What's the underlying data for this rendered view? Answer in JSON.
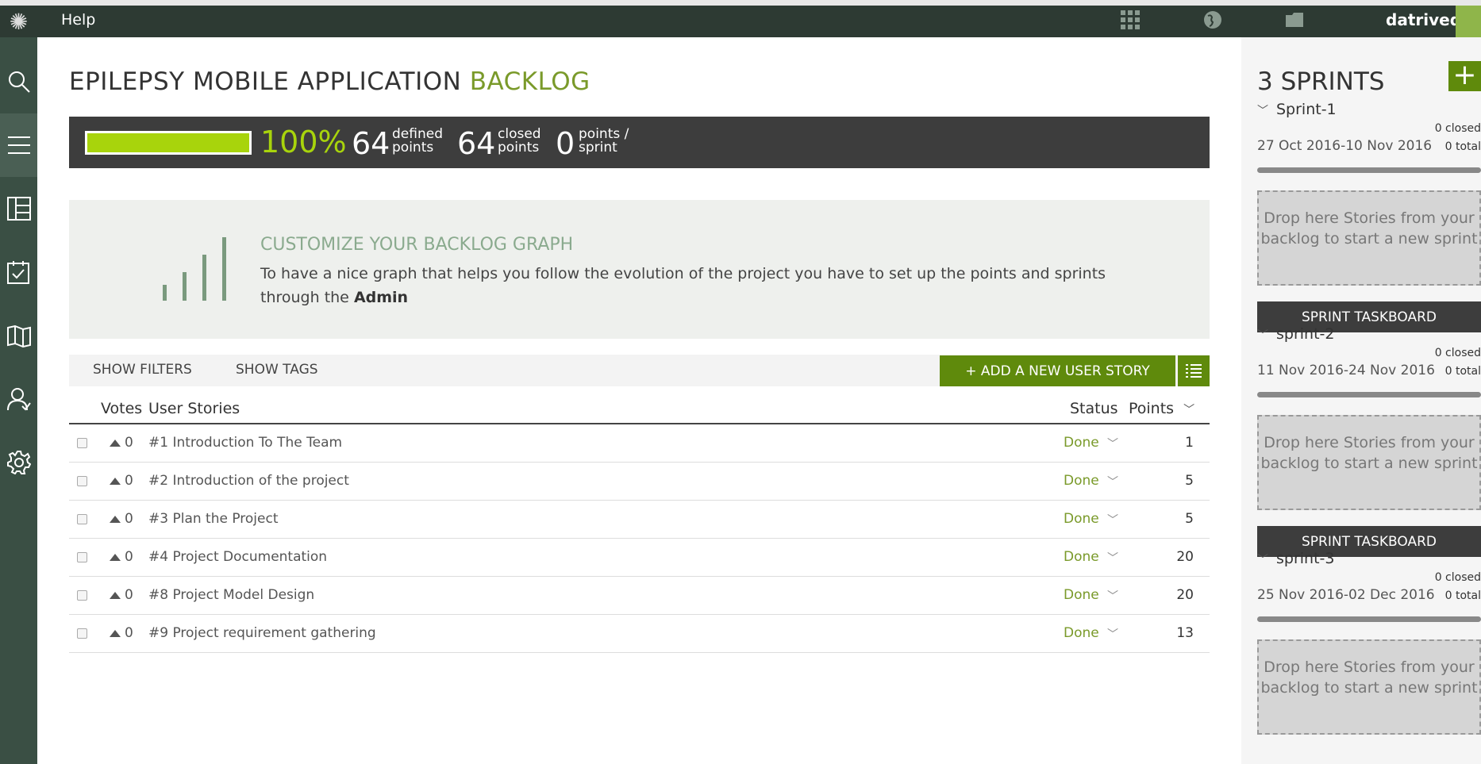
{
  "topbar": {
    "help": "Help",
    "username": "datrived"
  },
  "page": {
    "title_main": "EPILEPSY MOBILE APPLICATION",
    "title_accent": "BACKLOG"
  },
  "summary": {
    "progress_fraction": 1.0,
    "percent": "100%",
    "defined_value": "64",
    "defined_label_1": "defined",
    "defined_label_2": "points",
    "closed_value": "64",
    "closed_label_1": "closed",
    "closed_label_2": "points",
    "sprint_value": "0",
    "sprint_label_1": "points /",
    "sprint_label_2": "sprint"
  },
  "graph_notice": {
    "title": "CUSTOMIZE YOUR BACKLOG GRAPH",
    "text": "To have a nice graph that helps you follow the evolution of the project you have to set up the points and sprints through the",
    "link": "Admin"
  },
  "filters": {
    "show_filters": "SHOW FILTERS",
    "show_tags": "SHOW TAGS",
    "add_story": "+ ADD A NEW USER STORY"
  },
  "table": {
    "col_votes": "Votes",
    "col_stories": "User Stories",
    "col_status": "Status",
    "col_points": "Points",
    "rows": [
      {
        "votes": "0",
        "story": "#1 Introduction To The Team",
        "status": "Done",
        "points": "1"
      },
      {
        "votes": "0",
        "story": "#2 Introduction of the project",
        "status": "Done",
        "points": "5"
      },
      {
        "votes": "0",
        "story": "#3 Plan the Project",
        "status": "Done",
        "points": "5"
      },
      {
        "votes": "0",
        "story": "#4 Project Documentation",
        "status": "Done",
        "points": "20"
      },
      {
        "votes": "0",
        "story": "#8 Project Model Design",
        "status": "Done",
        "points": "20"
      },
      {
        "votes": "0",
        "story": "#9 Project requirement gathering",
        "status": "Done",
        "points": "13"
      }
    ]
  },
  "sprints": {
    "title": "3 SPRINTS",
    "drop_text": "Drop here Stories from your backlog to start a new sprint",
    "taskboard": "SPRINT TASKBOARD",
    "list": [
      {
        "name": "Sprint-1",
        "closed": "0 closed",
        "dates": "27 Oct 2016-10 Nov 2016",
        "total": "0 total"
      },
      {
        "name": "sprint-2",
        "closed": "0 closed",
        "dates": "11 Nov 2016-24 Nov 2016",
        "total": "0 total"
      },
      {
        "name": "sprint-3",
        "closed": "0 closed",
        "dates": "25 Nov 2016-02 Dec 2016",
        "total": "0 total"
      }
    ]
  },
  "colors": {
    "accent_green": "#7a9a2a",
    "button_green": "#5f8a0c",
    "progress_lime": "#a8d40c",
    "dark_bar": "#3d3d3d"
  }
}
